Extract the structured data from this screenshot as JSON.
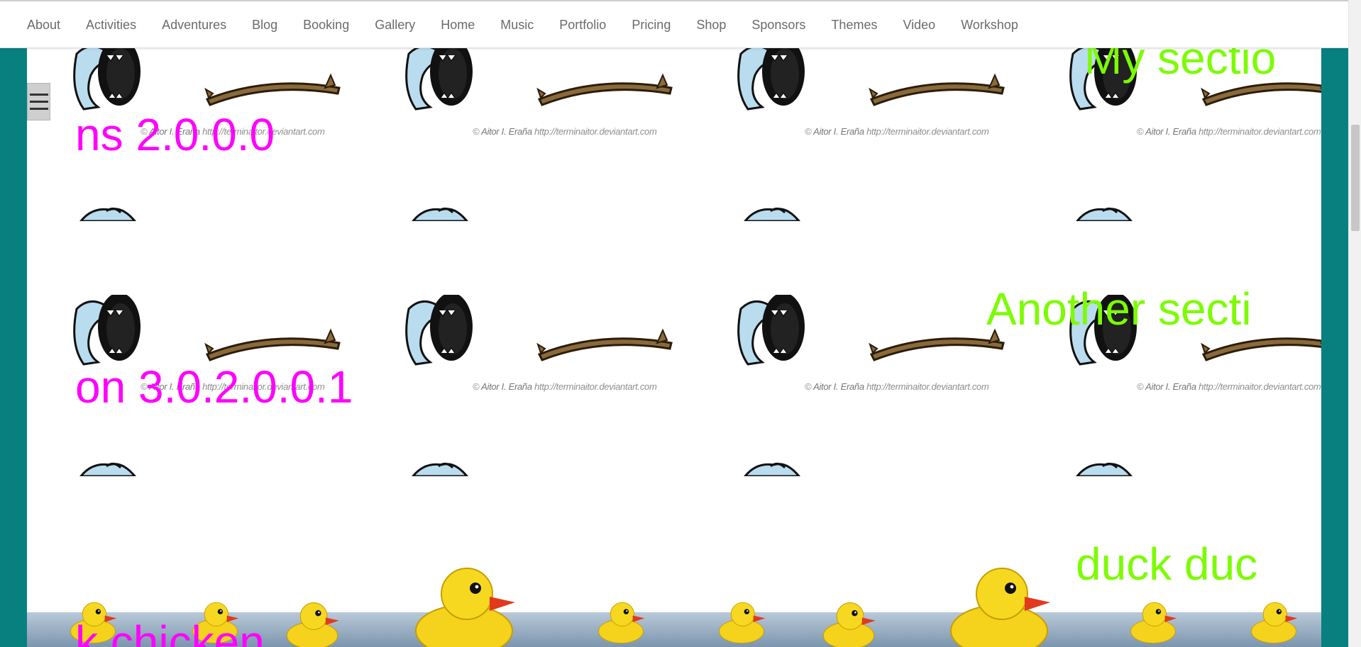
{
  "nav": {
    "items": [
      "About",
      "Activities",
      "Adventures",
      "Blog",
      "Booking",
      "Gallery",
      "Home",
      "Music",
      "Portfolio",
      "Pricing",
      "Shop",
      "Sponsors",
      "Themes",
      "Video",
      "Workshop"
    ]
  },
  "menu_button": {
    "icon": "hamburger-menu-icon"
  },
  "background": {
    "credit_name": "Aitor I. Eraña",
    "credit_url": "http://terminaitor.deviantart.com"
  },
  "sections": {
    "s1_right": "My sectio",
    "s1_left": "ns 2.0.0.0",
    "s2_right": "Another secti",
    "s2_left": "on 3.0.2.0.0.1",
    "s3_right": "duck duc",
    "s3_left": "k chicken"
  },
  "colors": {
    "side": "#098080",
    "green_text": "#7cfc00",
    "magenta_text": "#ff00ff"
  }
}
